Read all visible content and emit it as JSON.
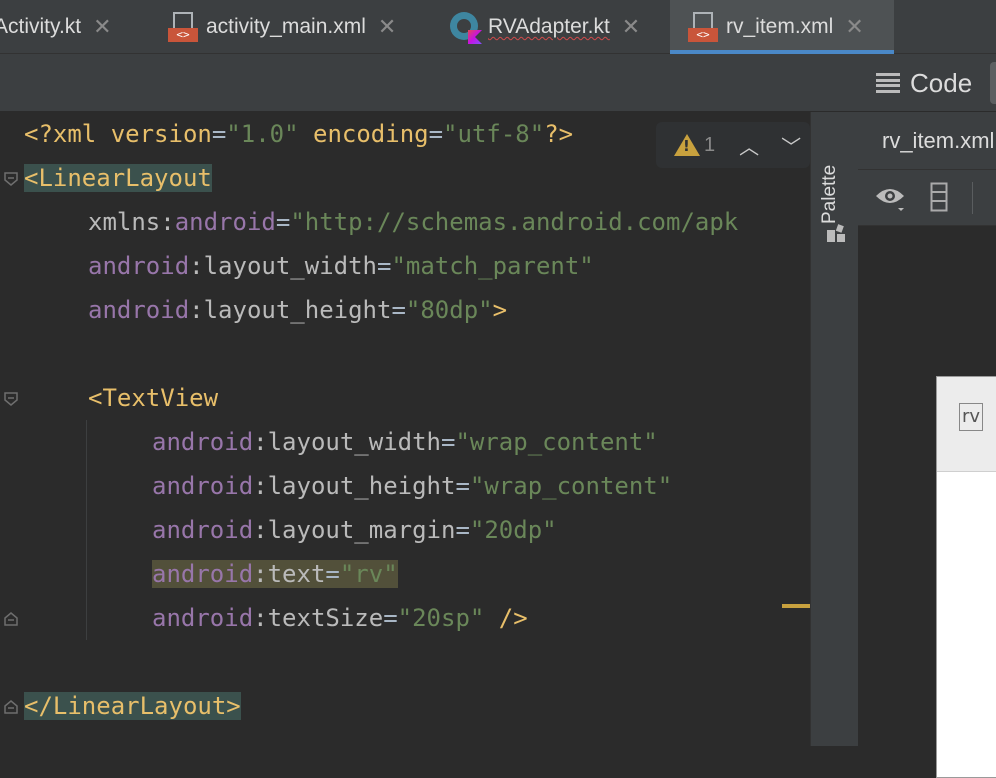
{
  "tabs": [
    {
      "label": "MainActivity.kt",
      "visible_label": "Activity.kt",
      "icon": "kotlin-file-icon",
      "active": false
    },
    {
      "label": "activity_main.xml",
      "icon": "xml-file-icon",
      "active": false
    },
    {
      "label": "RVAdapter.kt",
      "icon": "kotlin-file-icon",
      "active": false
    },
    {
      "label": "rv_item.xml",
      "icon": "xml-file-icon",
      "active": true
    }
  ],
  "toolbar": {
    "code_label": "Code"
  },
  "editor": {
    "warning_count": "1",
    "lines": {
      "l1_a": "<?xml version",
      "l1_b": "=",
      "l1_c": "\"1.0\"",
      "l1_d": " encoding",
      "l1_e": "=",
      "l1_f": "\"utf-8\"",
      "l1_g": "?>",
      "l2_tag": "<LinearLayout",
      "l3_attr": "xmlns:",
      "l3_ns": "android",
      "l3_eq": "=",
      "l3_val": "\"http://schemas.android.com/apk",
      "l4_ns": "android",
      "l4_attr": ":layout_width",
      "l4_eq": "=",
      "l4_val": "\"match_parent\"",
      "l5_ns": "android",
      "l5_attr": ":layout_height",
      "l5_eq": "=",
      "l5_val": "\"80dp\"",
      "l5_close": ">",
      "l7_tag": "<TextView",
      "l8_ns": "android",
      "l8_attr": ":layout_width",
      "l8_eq": "=",
      "l8_val": "\"wrap_content\"",
      "l9_ns": "android",
      "l9_attr": ":layout_height",
      "l9_eq": "=",
      "l9_val": "\"wrap_content\"",
      "l10_ns": "android",
      "l10_attr": ":layout_margin",
      "l10_eq": "=",
      "l10_val": "\"20dp\"",
      "l11_ns": "android",
      "l11_attr": ":text",
      "l11_eq": "=",
      "l11_val": "\"rv\"",
      "l12_ns": "android",
      "l12_attr": ":textSize",
      "l12_eq": "=",
      "l12_val": "\"20sp\"",
      "l12_close": " />",
      "l14_tag": "</LinearLayout>"
    }
  },
  "palette": {
    "label": "Palette"
  },
  "design": {
    "title": "rv_item.xml",
    "preview_text": "rv"
  },
  "colors": {
    "accent": "#4a88c7",
    "tag": "#e8bf6a",
    "attr_ns": "#9876aa",
    "string": "#6a8759",
    "warning": "#c8a13e"
  }
}
